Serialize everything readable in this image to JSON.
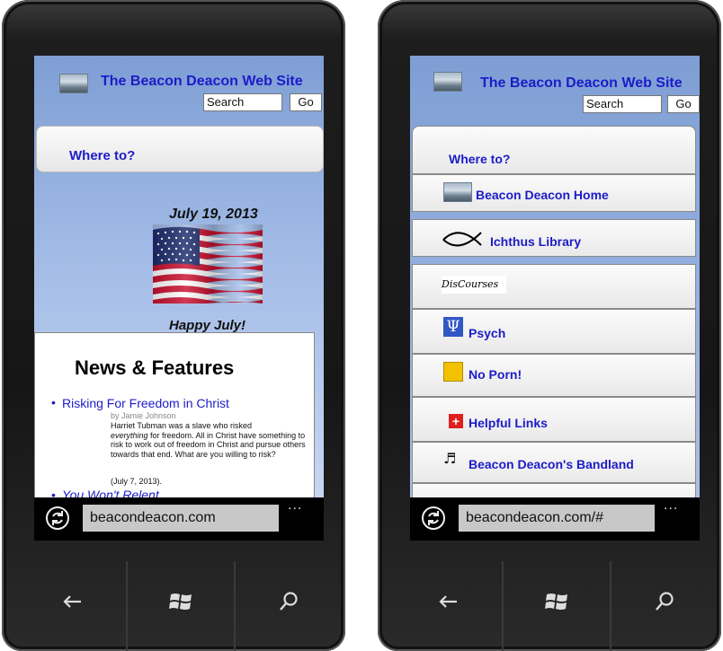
{
  "left_phone": {
    "site": {
      "title": "The Beacon Deacon Web Site",
      "search_placeholder": "Search",
      "go_label": "Go"
    },
    "nav_label": "Where to?",
    "banner": {
      "date": "July 19, 2013",
      "message": "Happy July!"
    },
    "news": {
      "heading": "News & Features",
      "articles": [
        {
          "title": "Risking For Freedom in Christ",
          "byline": "by Jamie Johnson",
          "desc_prefix": "Harriet Tubman was a slave who risked",
          "desc_em": "everything",
          "desc_rest": " for freedom. All in Christ have something to risk to work out of freedom in Christ and pursue others towards that end. What are you willing to risk?",
          "date": "(July 7, 2013)."
        },
        {
          "title": "You Won't Relent"
        }
      ]
    },
    "browser": {
      "url": "beacondeacon.com",
      "more": "..."
    }
  },
  "right_phone": {
    "site": {
      "title": "The Beacon Deacon Web Site",
      "search_placeholder": "Search",
      "go_label": "Go"
    },
    "nav_label": "Where to?",
    "menu": [
      {
        "label": "Beacon Deacon Home",
        "icon": "lighthouse-icon"
      },
      {
        "label": "Ichthus Library",
        "icon": "ichthus-fish-icon"
      },
      {
        "label": "",
        "icon": "discourses-logo-icon",
        "logo_text": "DisCourses"
      },
      {
        "label": "Psych",
        "icon": "psi-icon"
      },
      {
        "label": "No Porn!",
        "icon": "take-your-stand-icon"
      },
      {
        "label": "Helpful Links",
        "icon": "red-cross-icon"
      },
      {
        "label": "Beacon Deacon's Bandland",
        "icon": "music-notes-icon"
      }
    ],
    "browser": {
      "url": "beacondeacon.com/#",
      "more": "..."
    }
  },
  "colors": {
    "link": "#1c1cc8",
    "sky_top": "#7e9ed4",
    "sky_bottom": "#c7d6f2",
    "url_field": "#c8c8c8"
  }
}
